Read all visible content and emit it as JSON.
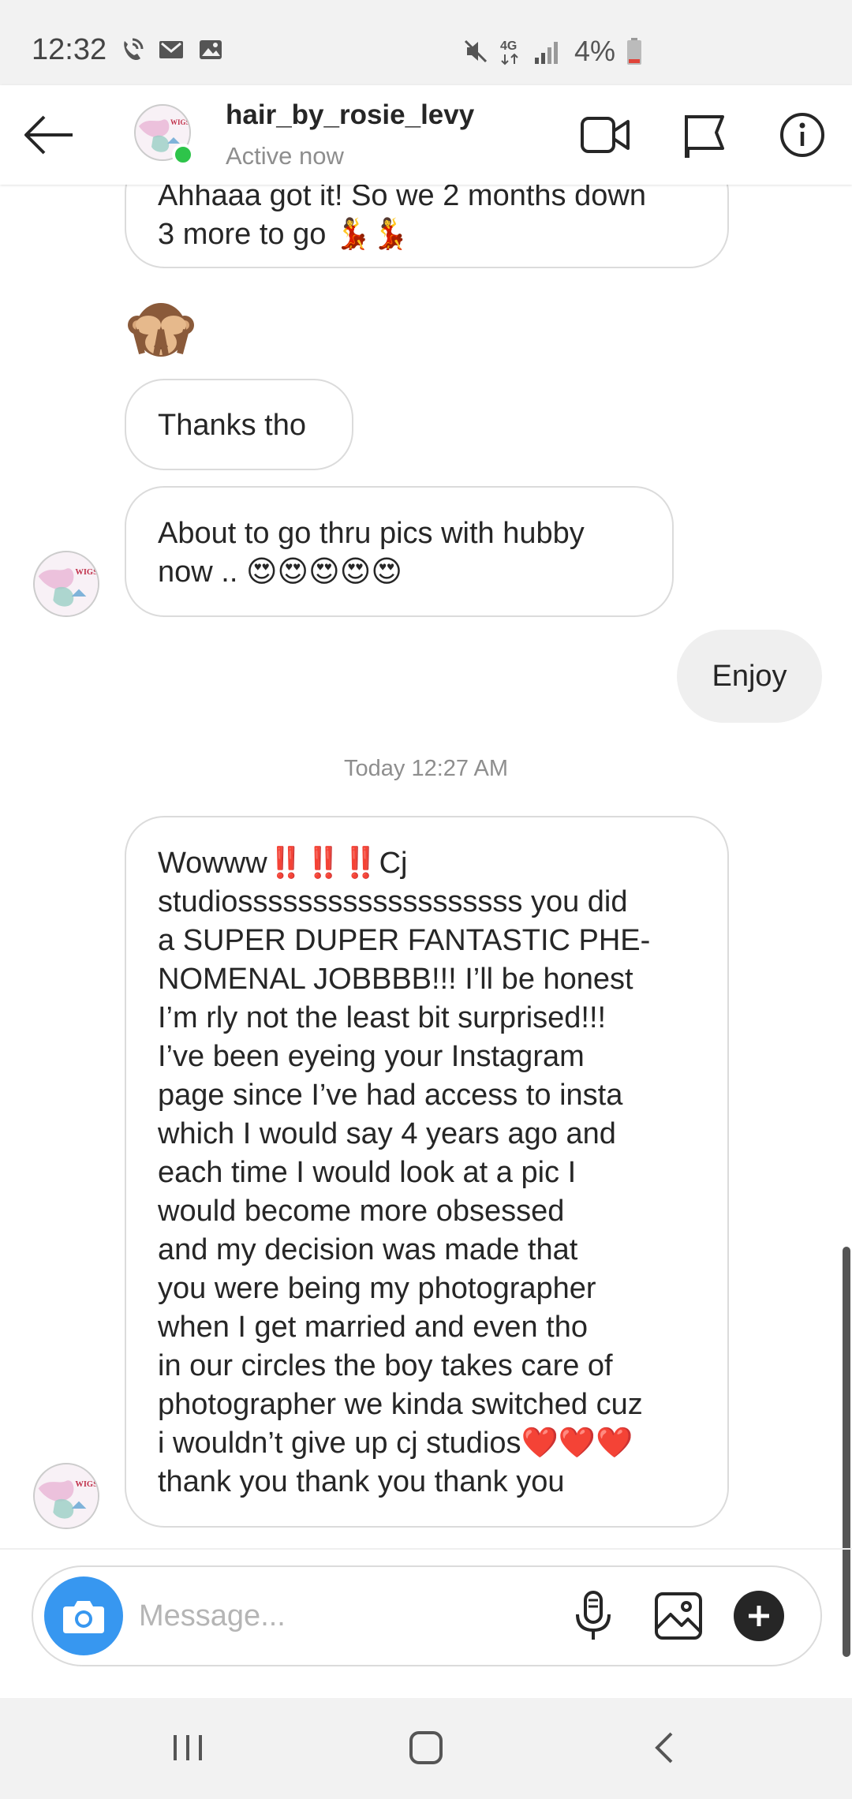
{
  "status_bar": {
    "time": "12:32",
    "battery_text": "4%"
  },
  "header": {
    "username": "hair_by_rosie_levy",
    "status": "Active now"
  },
  "messages": {
    "msg1_line1": "Ahhaaa got it! So we 2 months down",
    "msg1_line2": "3 more to go 💃💃",
    "msg2": "Thanks tho",
    "msg3_line1": "About to go thru pics with hubby",
    "msg3_line2": "now .. 😍😍😍😍😍",
    "msg4": "Enjoy",
    "timestamp": "Today 12:27 AM",
    "msg5_lines": [
      "Wowww‼️‼️‼️Cj",
      "studiosssssssssssssssssss you did",
      "a SUPER DUPER FANTASTIC PHE-",
      "NOMENAL JOBBBB!!! I’ll be honest",
      "I’m rly not the least bit surprised!!!",
      "I’ve been eyeing your Instagram",
      "page since I’ve had access to insta",
      "which I would say 4 years ago and",
      "each time I would look at a pic I",
      "would become more obsessed",
      "and my decision was made that",
      "you were being my photographer",
      "when I get married and even tho",
      "in our circles the boy takes care of",
      "photographer we kinda switched cuz",
      "i wouldn’t give up cj studios❤️❤️❤️",
      "thank you thank you thank you"
    ]
  },
  "composer": {
    "placeholder": "Message..."
  },
  "colors": {
    "accent_blue": "#3797f0",
    "online_green": "#2ec44a",
    "bubble_border": "#dbdbdb",
    "outgoing_bubble": "#efefef"
  },
  "icons": {
    "back": "arrow-left-icon",
    "video": "video-camera-icon",
    "flag": "flag-icon",
    "info": "info-icon",
    "camera": "camera-icon",
    "mic": "microphone-icon",
    "gallery": "image-icon",
    "plus": "plus-circle-icon"
  }
}
